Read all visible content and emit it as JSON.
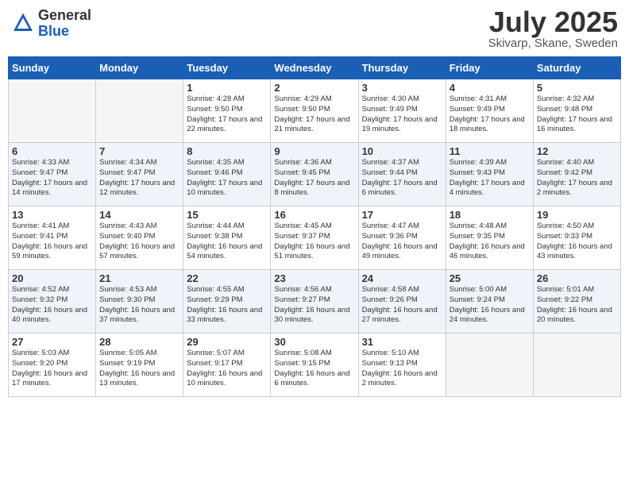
{
  "header": {
    "logo_general": "General",
    "logo_blue": "Blue",
    "month_title": "July 2025",
    "location": "Skivarp, Skane, Sweden"
  },
  "weekdays": [
    "Sunday",
    "Monday",
    "Tuesday",
    "Wednesday",
    "Thursday",
    "Friday",
    "Saturday"
  ],
  "weeks": [
    [
      {
        "day": "",
        "info": ""
      },
      {
        "day": "",
        "info": ""
      },
      {
        "day": "1",
        "info": "Sunrise: 4:28 AM\nSunset: 9:50 PM\nDaylight: 17 hours and 22 minutes."
      },
      {
        "day": "2",
        "info": "Sunrise: 4:29 AM\nSunset: 9:50 PM\nDaylight: 17 hours and 21 minutes."
      },
      {
        "day": "3",
        "info": "Sunrise: 4:30 AM\nSunset: 9:49 PM\nDaylight: 17 hours and 19 minutes."
      },
      {
        "day": "4",
        "info": "Sunrise: 4:31 AM\nSunset: 9:49 PM\nDaylight: 17 hours and 18 minutes."
      },
      {
        "day": "5",
        "info": "Sunrise: 4:32 AM\nSunset: 9:48 PM\nDaylight: 17 hours and 16 minutes."
      }
    ],
    [
      {
        "day": "6",
        "info": "Sunrise: 4:33 AM\nSunset: 9:47 PM\nDaylight: 17 hours and 14 minutes."
      },
      {
        "day": "7",
        "info": "Sunrise: 4:34 AM\nSunset: 9:47 PM\nDaylight: 17 hours and 12 minutes."
      },
      {
        "day": "8",
        "info": "Sunrise: 4:35 AM\nSunset: 9:46 PM\nDaylight: 17 hours and 10 minutes."
      },
      {
        "day": "9",
        "info": "Sunrise: 4:36 AM\nSunset: 9:45 PM\nDaylight: 17 hours and 8 minutes."
      },
      {
        "day": "10",
        "info": "Sunrise: 4:37 AM\nSunset: 9:44 PM\nDaylight: 17 hours and 6 minutes."
      },
      {
        "day": "11",
        "info": "Sunrise: 4:39 AM\nSunset: 9:43 PM\nDaylight: 17 hours and 4 minutes."
      },
      {
        "day": "12",
        "info": "Sunrise: 4:40 AM\nSunset: 9:42 PM\nDaylight: 17 hours and 2 minutes."
      }
    ],
    [
      {
        "day": "13",
        "info": "Sunrise: 4:41 AM\nSunset: 9:41 PM\nDaylight: 16 hours and 59 minutes."
      },
      {
        "day": "14",
        "info": "Sunrise: 4:43 AM\nSunset: 9:40 PM\nDaylight: 16 hours and 57 minutes."
      },
      {
        "day": "15",
        "info": "Sunrise: 4:44 AM\nSunset: 9:38 PM\nDaylight: 16 hours and 54 minutes."
      },
      {
        "day": "16",
        "info": "Sunrise: 4:45 AM\nSunset: 9:37 PM\nDaylight: 16 hours and 51 minutes."
      },
      {
        "day": "17",
        "info": "Sunrise: 4:47 AM\nSunset: 9:36 PM\nDaylight: 16 hours and 49 minutes."
      },
      {
        "day": "18",
        "info": "Sunrise: 4:48 AM\nSunset: 9:35 PM\nDaylight: 16 hours and 46 minutes."
      },
      {
        "day": "19",
        "info": "Sunrise: 4:50 AM\nSunset: 9:33 PM\nDaylight: 16 hours and 43 minutes."
      }
    ],
    [
      {
        "day": "20",
        "info": "Sunrise: 4:52 AM\nSunset: 9:32 PM\nDaylight: 16 hours and 40 minutes."
      },
      {
        "day": "21",
        "info": "Sunrise: 4:53 AM\nSunset: 9:30 PM\nDaylight: 16 hours and 37 minutes."
      },
      {
        "day": "22",
        "info": "Sunrise: 4:55 AM\nSunset: 9:29 PM\nDaylight: 16 hours and 33 minutes."
      },
      {
        "day": "23",
        "info": "Sunrise: 4:56 AM\nSunset: 9:27 PM\nDaylight: 16 hours and 30 minutes."
      },
      {
        "day": "24",
        "info": "Sunrise: 4:58 AM\nSunset: 9:26 PM\nDaylight: 16 hours and 27 minutes."
      },
      {
        "day": "25",
        "info": "Sunrise: 5:00 AM\nSunset: 9:24 PM\nDaylight: 16 hours and 24 minutes."
      },
      {
        "day": "26",
        "info": "Sunrise: 5:01 AM\nSunset: 9:22 PM\nDaylight: 16 hours and 20 minutes."
      }
    ],
    [
      {
        "day": "27",
        "info": "Sunrise: 5:03 AM\nSunset: 9:20 PM\nDaylight: 16 hours and 17 minutes."
      },
      {
        "day": "28",
        "info": "Sunrise: 5:05 AM\nSunset: 9:19 PM\nDaylight: 16 hours and 13 minutes."
      },
      {
        "day": "29",
        "info": "Sunrise: 5:07 AM\nSunset: 9:17 PM\nDaylight: 16 hours and 10 minutes."
      },
      {
        "day": "30",
        "info": "Sunrise: 5:08 AM\nSunset: 9:15 PM\nDaylight: 16 hours and 6 minutes."
      },
      {
        "day": "31",
        "info": "Sunrise: 5:10 AM\nSunset: 9:13 PM\nDaylight: 16 hours and 2 minutes."
      },
      {
        "day": "",
        "info": ""
      },
      {
        "day": "",
        "info": ""
      }
    ]
  ]
}
